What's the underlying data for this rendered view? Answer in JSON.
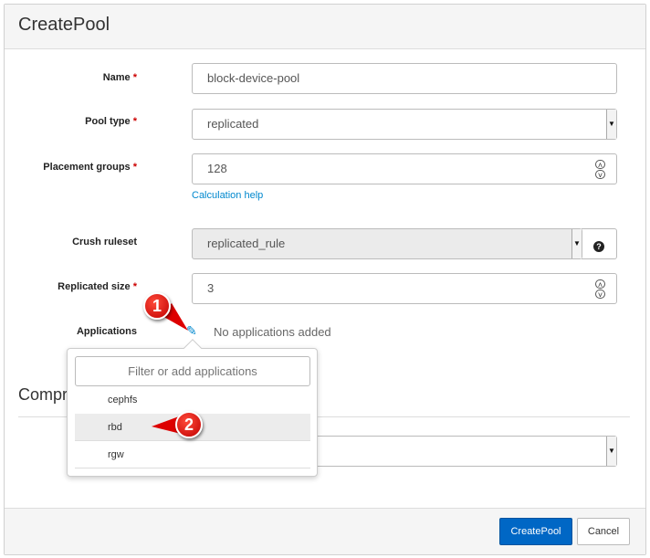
{
  "title": "CreatePool",
  "fields": {
    "name": {
      "label": "Name",
      "required": "*",
      "value": "block-device-pool"
    },
    "pool_type": {
      "label": "Pool type",
      "required": "*",
      "value": "replicated"
    },
    "pg": {
      "label": "Placement groups",
      "required": "*",
      "value": "128",
      "help": "Calculation help"
    },
    "crush": {
      "label": "Crush ruleset",
      "value": "replicated_rule",
      "help_icon": "question-circle-icon"
    },
    "size": {
      "label": "Replicated size",
      "required": "*",
      "value": "3"
    },
    "apps": {
      "label": "Applications",
      "empty": "No applications added",
      "edit_icon": "pencil-icon"
    }
  },
  "popover": {
    "placeholder": "Filter or add applications",
    "items": [
      "cephfs",
      "rbd",
      "rgw"
    ],
    "highlighted": "rbd"
  },
  "compression": {
    "heading": "Compression"
  },
  "footer": {
    "submit": "CreatePool",
    "cancel": "Cancel"
  },
  "annotations": [
    "1",
    "2"
  ],
  "colors": {
    "primary": "#0067c5",
    "link": "#0088ce",
    "required": "#cc0000",
    "callout": "#e00000"
  }
}
